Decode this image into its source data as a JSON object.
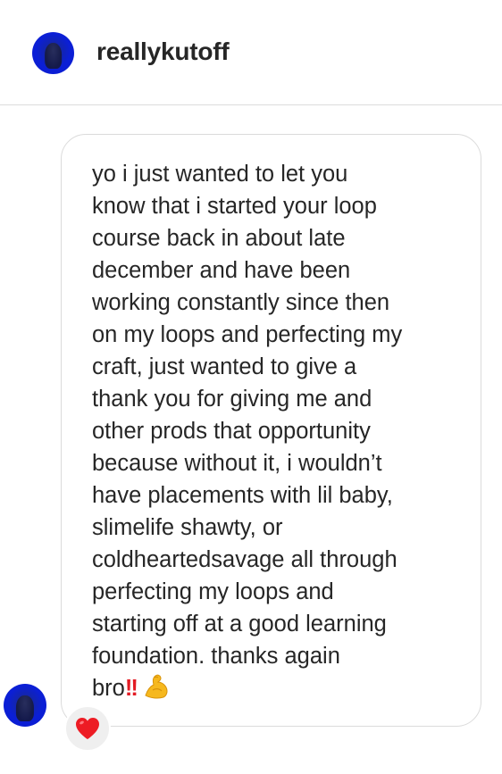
{
  "header": {
    "username": "reallykutoff",
    "avatar_icon": "profile-avatar"
  },
  "message": {
    "text": "yo i just wanted to let you\nknow that i started your loop\ncourse back in about late\ndecember and have been\nworking constantly since then\non my loops and perfecting my\ncraft, just wanted to give a\nthank you for giving me and\nother prods that opportunity\nbecause without it, i wouldn’t\nhave placements with lil baby,\nslimelife shawty, or\ncoldheartedsavage all through\nperfecting my loops and\nstarting off at a good learning\nfoundation. thanks again\nbro",
    "trailing_emoji": [
      "double-exclamation-icon",
      "flexed-biceps-icon"
    ],
    "bangs": "‼️"
  },
  "reaction": {
    "icon": "red-heart-icon",
    "color": "#ed1c24"
  },
  "colors": {
    "text": "#262626",
    "border": "#dbdbdb",
    "avatar_blue": "#0a1ad0"
  }
}
